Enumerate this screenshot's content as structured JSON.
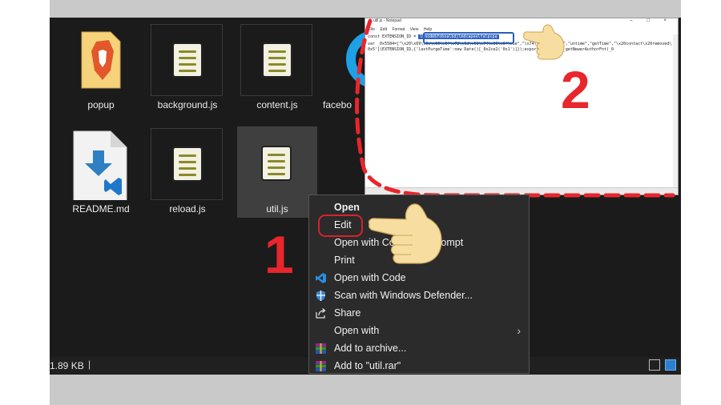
{
  "explorer": {
    "files": [
      {
        "name": "popup",
        "icon": "brave-lion-icon"
      },
      {
        "name": "background.js",
        "icon": "script-file-icon"
      },
      {
        "name": "content.js",
        "icon": "script-file-icon"
      },
      {
        "name": "facebo",
        "icon": "messenger-icon"
      },
      {
        "name": "README.md",
        "icon": "vscode-file-icon"
      },
      {
        "name": "reload.js",
        "icon": "script-file-icon"
      },
      {
        "name": "util.js",
        "icon": "script-file-icon"
      }
    ],
    "status": {
      "size": "1.89 KB",
      "separator": "|"
    }
  },
  "notepad": {
    "title": "util.js - Notepad",
    "menu": [
      "File",
      "Edit",
      "Format",
      "View",
      "Help"
    ],
    "line1_prefix": "const EXTENSION_ID = ",
    "line1_highlight": "lbnodmbfoboalbdjlmdcapeelfalpcpa",
    "line2": "var _0x5584=[\"\\x20\\x69\\x6e\\x66\\x6f\\x72\\x6d\\x61\\x74\\x69\\x6f\\x6e\",\"\\x74\\x69\\x6d\\x65\",\"untime\",\"getTime\",\"\\x20contact\\x20removed\\x20a",
    "line3": "0x5'](EXTENSION_ID,{'lastPurgeTime':new Date()[_0x2ce2('0x1')]});export function _getNewerAuthorFnt(_0"
  },
  "steps": {
    "one": "1",
    "two": "2"
  },
  "context_menu": {
    "items": [
      {
        "label": "Open",
        "bold": true
      },
      {
        "label": "Edit"
      },
      {
        "label": "Open with Command Prompt"
      },
      {
        "label": "Print"
      },
      {
        "label": "Open with Code",
        "icon": "vscode-icon"
      },
      {
        "label": "Scan with Windows Defender...",
        "icon": "defender-shield-icon"
      },
      {
        "label": "Share",
        "icon": "share-icon"
      },
      {
        "label": "Open with"
      },
      {
        "label": "Add to archive...",
        "icon": "winrar-icon"
      },
      {
        "label": "Add to \"util.rar\"",
        "icon": "winrar-icon"
      }
    ]
  },
  "colors": {
    "annotation_red": "#e8262c",
    "highlight_blue": "#2f64c4",
    "explorer_bg": "#1b1b1b"
  }
}
